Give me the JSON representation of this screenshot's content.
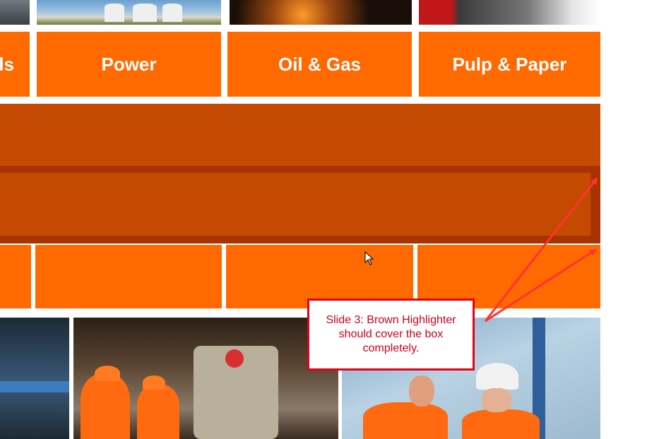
{
  "industry_tiles": [
    {
      "label": "ls"
    },
    {
      "label": "Power"
    },
    {
      "label": "Oil & Gas"
    },
    {
      "label": "Pulp & Paper"
    }
  ],
  "annotation": {
    "text": "Slide 3: Brown Highlighter should cover the box completely.",
    "border_color": "#e3001b",
    "text_color": "#d0001b",
    "arrow_color": "#ff3333"
  },
  "colors": {
    "tile_orange": "#ff6a00",
    "band_brown": "#c34a00",
    "band_dark_brown": "#a83200"
  }
}
